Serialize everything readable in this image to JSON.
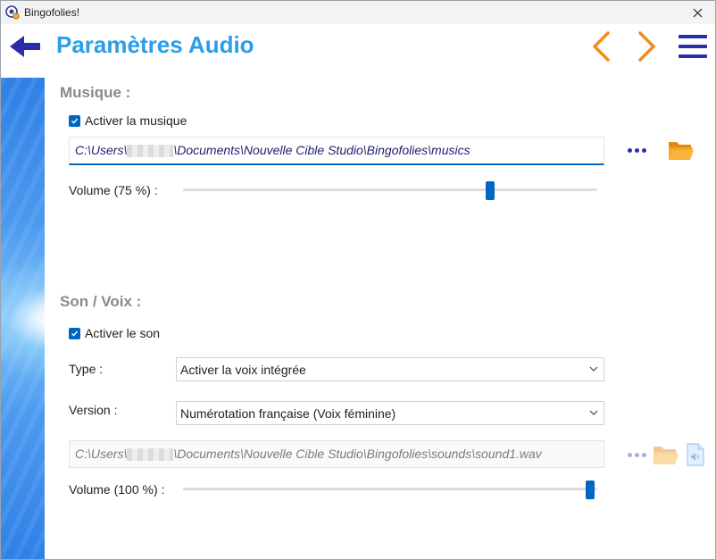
{
  "window": {
    "title": "Bingofolies!"
  },
  "header": {
    "title": "Paramètres Audio"
  },
  "music": {
    "section_title": "Musique :",
    "enable_label": "Activer la musique",
    "enabled": true,
    "path_prefix": "C:\\Users\\",
    "path_suffix": "\\Documents\\Nouvelle Cible Studio\\Bingofolies\\musics",
    "volume_label": "Volume (75 %) :",
    "volume": 75
  },
  "sound": {
    "section_title": "Son / Voix :",
    "enable_label": "Activer le son",
    "enabled": true,
    "type_label": "Type :",
    "type_value": "Activer la voix intégrée",
    "version_label": "Version :",
    "version_value": "Numérotation française (Voix féminine)",
    "path_prefix": "C:\\Users\\",
    "path_suffix": "\\Documents\\Nouvelle Cible Studio\\Bingofolies\\sounds\\sound1.wav",
    "volume_label": "Volume (100 %) :",
    "volume": 100
  },
  "colors": {
    "accent": "#2a9ee8",
    "nav_orange": "#f28c1b",
    "menu_blue": "#2b2bb0",
    "checkbox_blue": "#0067c0"
  },
  "icons": {
    "back": "arrow-left-icon",
    "prev": "chevron-left-icon",
    "next": "chevron-right-icon",
    "menu": "hamburger-menu-icon",
    "browse": "more-dots-icon",
    "folder": "folder-open-icon",
    "sound_file": "audio-file-icon",
    "close": "close-icon"
  }
}
